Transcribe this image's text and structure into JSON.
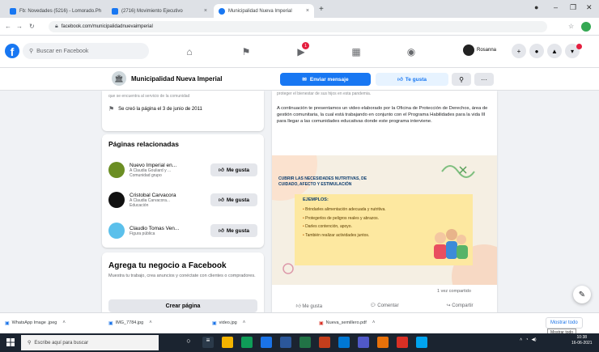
{
  "browser": {
    "tabs": [
      {
        "title": "Fb: Novedades (5216) - Lomorado.Ph"
      },
      {
        "title": "(2716) Movimiento Ejecutivo"
      },
      {
        "title": "Municipalidad Nueva Imperial",
        "active": true
      }
    ],
    "new_tab": "+",
    "address": "facebook.com/municipalidadnuevaimperial"
  },
  "facebook": {
    "logo": "f",
    "search_placeholder": "Buscar en Facebook",
    "messenger_badge": "1",
    "profile_name": "Rosanna"
  },
  "page_header": {
    "name": "Municipalidad Nueva Imperial",
    "send_message": "Enviar mensaje",
    "like": "Te gusta",
    "more": "···"
  },
  "about": {
    "faded_text": "que se encuentra al servicio de la comunidad",
    "created": "Se creó la página el 3 de junio de 2011"
  },
  "related": {
    "title": "Páginas relacionadas",
    "like_label": "Me gusta",
    "items": [
      {
        "name": "Nuevo Imperial en...",
        "sub": "A Claudia Gouliard y ...",
        "category": "Comunidad grupo",
        "color": "#6b8e23"
      },
      {
        "name": "Cristobal Carvacora",
        "sub": "A Claudia Carvacora...",
        "category": "Educación",
        "color": "#111111"
      },
      {
        "name": "Claudio Tomas Ven...",
        "sub": "Figura pública",
        "category": "",
        "color": "#5bc0eb"
      }
    ]
  },
  "business": {
    "title": "Agrega tu negocio a Facebook",
    "desc": "Muestra tu trabajo, crea anuncios y conéctate con clientes o compradores.",
    "button": "Crear página"
  },
  "post": {
    "top_text": "proteger el bienestar de sus hijos en esta pandemia.",
    "body": "A continuación te presentamos un video elaborado por la Oficina de Protección de Derechos, área de gestión comunitaria, la cual está trabajando en conjunto con el Programa Habilidades para la vida III para llegar a las comunidades educativas donde este programa interviene.",
    "image_title": "CUBRIR LAS NECESIDADES NUTRITIVAS, DE CUIDADO, AFECTO Y ESTIMULACIÓN",
    "examples_label": "EJEMPLOS:",
    "bullets": [
      "Brindarles alimentación adecuada y nutritiva.",
      "Protegerlos de peligros reales y abrazos.",
      "Darles contención, apoyo.",
      "También realizar actividades juntos."
    ],
    "shares": "1 vez compartido",
    "actions": [
      "Me gusta",
      "Comentar",
      "Compartir"
    ]
  },
  "downloads": [
    {
      "name": "WhatsApp Image .jpeg"
    },
    {
      "name": "IMG_7784.jpg"
    },
    {
      "name": "video.jpg"
    },
    {
      "name": "Nueva_semillero.pdf"
    }
  ],
  "downloads_show_all": "Mostrar todo",
  "downloads_tooltip": "Mostrar todo",
  "taskbar": {
    "search_placeholder": "Escribe aquí para buscar",
    "time": "10:38",
    "date": "16-06-2021"
  },
  "colors": {
    "facebook_blue": "#1877f2",
    "taskbar": "#1b2430",
    "poster_yellow": "#fde8a0"
  }
}
